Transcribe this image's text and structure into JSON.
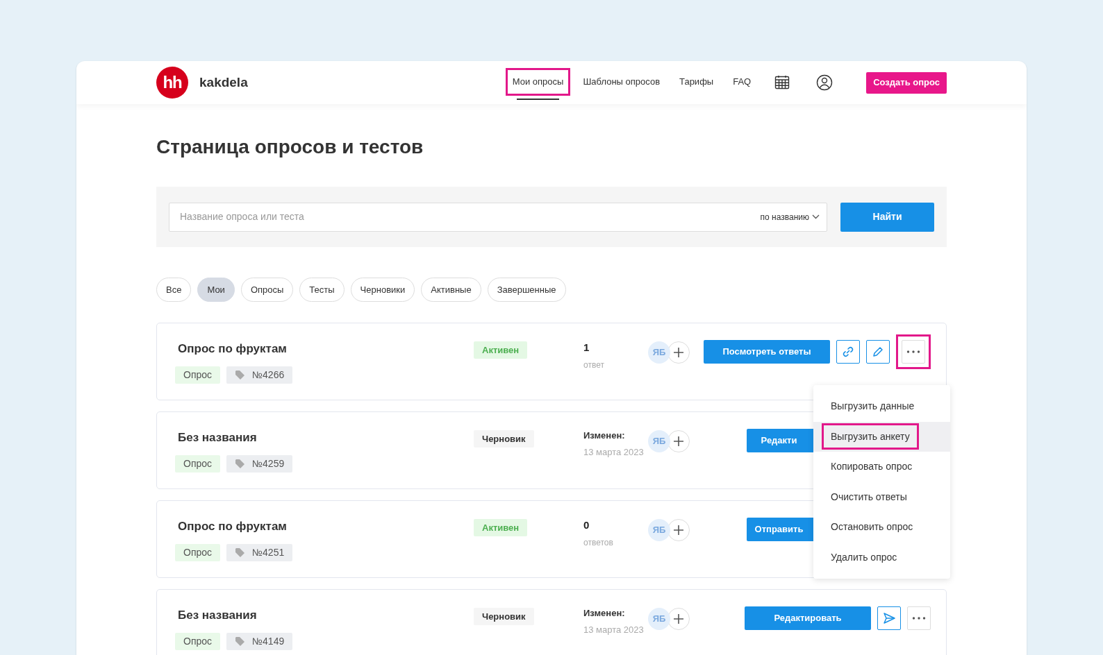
{
  "brand": {
    "logo": "hh",
    "name": "kakdela"
  },
  "nav": [
    {
      "label": "Мои опросы",
      "selected": true,
      "highlighted": true
    },
    {
      "label": "Шаблоны опросов",
      "selected": false,
      "highlighted": false
    },
    {
      "label": "Тарифы",
      "selected": false,
      "highlighted": false
    },
    {
      "label": "FAQ",
      "selected": false,
      "highlighted": false
    }
  ],
  "create_button": "Создать опрос",
  "page_title": "Страница опросов и тестов",
  "search": {
    "placeholder": "Название опроса или теста",
    "sort": "по названию",
    "button": "Найти"
  },
  "filters": [
    {
      "label": "Все",
      "selected": false
    },
    {
      "label": "Мои",
      "selected": true
    },
    {
      "label": "Опросы",
      "selected": false
    },
    {
      "label": "Тесты",
      "selected": false
    },
    {
      "label": "Черновики",
      "selected": false
    },
    {
      "label": "Активные",
      "selected": false
    },
    {
      "label": "Завершенные",
      "selected": false
    }
  ],
  "rows": [
    {
      "title": "Опрос по фруктам",
      "type": "Опрос",
      "number": "№4266",
      "status": {
        "label": "Активен",
        "kind": "active"
      },
      "stat": {
        "kind": "count",
        "value": "1",
        "caption": "ответ"
      },
      "avatar": "ЯБ",
      "primary": "Посмотреть ответы",
      "actions": [
        {
          "kind": "link",
          "highlighted": false
        },
        {
          "kind": "edit",
          "highlighted": false
        },
        {
          "kind": "more",
          "highlighted": true
        }
      ]
    },
    {
      "title": "Без названия",
      "type": "Опрос",
      "number": "№4259",
      "status": {
        "label": "Черновик",
        "kind": "draft"
      },
      "stat": {
        "kind": "modified",
        "value": "Изменен:",
        "caption": "13 марта 2023"
      },
      "avatar": "ЯБ",
      "primary": "Редакти",
      "actions": []
    },
    {
      "title": "Опрос по фруктам",
      "type": "Опрос",
      "number": "№4251",
      "status": {
        "label": "Активен",
        "kind": "active"
      },
      "stat": {
        "kind": "count",
        "value": "0",
        "caption": "ответов"
      },
      "avatar": "ЯБ",
      "primary": "Отправить",
      "actions": []
    },
    {
      "title": "Без названия",
      "type": "Опрос",
      "number": "№4149",
      "status": {
        "label": "Черновик",
        "kind": "draft"
      },
      "stat": {
        "kind": "modified",
        "value": "Изменен:",
        "caption": "13 марта 2023"
      },
      "avatar": "ЯБ",
      "primary": "Редактировать",
      "actions": [
        {
          "kind": "send",
          "highlighted": false
        },
        {
          "kind": "more",
          "highlighted": false
        }
      ]
    }
  ],
  "menu": {
    "items": [
      {
        "label": "Выгрузить данные",
        "hovered": false,
        "highlighted": false
      },
      {
        "label": "Выгрузить анкету",
        "hovered": true,
        "highlighted": true
      },
      {
        "label": "Копировать опрос",
        "hovered": false,
        "highlighted": false
      },
      {
        "label": "Очистить ответы",
        "hovered": false,
        "highlighted": false
      },
      {
        "label": "Остановить опрос",
        "hovered": false,
        "highlighted": false
      },
      {
        "label": "Удалить опрос",
        "hovered": false,
        "highlighted": false
      }
    ]
  }
}
